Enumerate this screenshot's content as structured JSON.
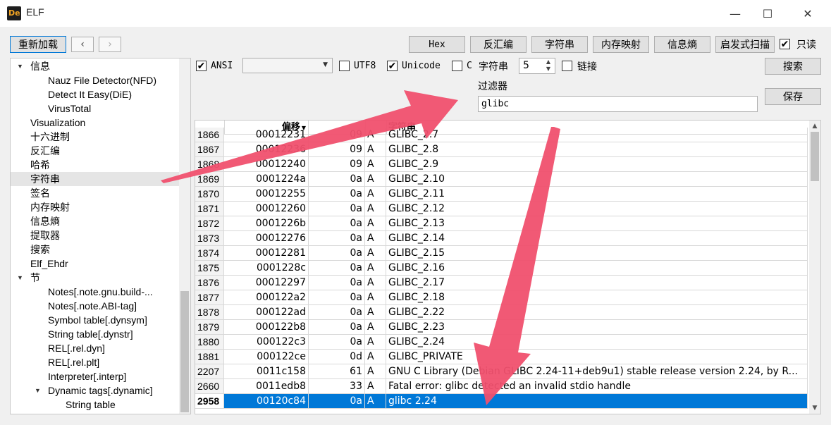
{
  "window": {
    "title": "ELF",
    "minimize": "—",
    "maximize": "☐",
    "close": "✕",
    "app_icon_text": "De"
  },
  "toolbar": {
    "reload_label": "重新加载",
    "back_glyph": "‹",
    "forward_glyph": "›",
    "tabs": [
      "Hex",
      "反汇编",
      "字符串",
      "内存映射",
      "信息熵",
      "启发式扫描"
    ],
    "readonly_label": "只读",
    "readonly_checked": true
  },
  "filters": {
    "ansi_label": "ANSI",
    "ansi_checked": true,
    "encoding_value": "",
    "utf8_label": "UTF8",
    "utf8_checked": false,
    "unicode_label": "Unicode",
    "unicode_checked": true,
    "c_label": "C",
    "c_checked": false,
    "string_label": "字符串",
    "min_length": "5",
    "link_label": "链接",
    "link_checked": false,
    "search_label": "搜索",
    "filter_label": "过滤器",
    "filter_value": "glibc",
    "save_label": "保存"
  },
  "tree": [
    {
      "label": "信息",
      "level": 0,
      "expanded": true
    },
    {
      "label": "Nauz File Detector(NFD)",
      "level": 2
    },
    {
      "label": "Detect It Easy(DiE)",
      "level": 2
    },
    {
      "label": "VirusTotal",
      "level": 2
    },
    {
      "label": "Visualization",
      "level": 1
    },
    {
      "label": "十六进制",
      "level": 1
    },
    {
      "label": "反汇编",
      "level": 1
    },
    {
      "label": "哈希",
      "level": 1
    },
    {
      "label": "字符串",
      "level": 1,
      "selected": true
    },
    {
      "label": "签名",
      "level": 1
    },
    {
      "label": "内存映射",
      "level": 1
    },
    {
      "label": "信息熵",
      "level": 1
    },
    {
      "label": "提取器",
      "level": 1
    },
    {
      "label": "搜索",
      "level": 1
    },
    {
      "label": "Elf_Ehdr",
      "level": 1
    },
    {
      "label": "节",
      "level": 0,
      "expanded": true
    },
    {
      "label": "Notes[.note.gnu.build-...",
      "level": 2
    },
    {
      "label": "Notes[.note.ABI-tag]",
      "level": 2
    },
    {
      "label": "Symbol table[.dynsym]",
      "level": 2
    },
    {
      "label": "String table[.dynstr]",
      "level": 2
    },
    {
      "label": "REL[.rel.dyn]",
      "level": 2
    },
    {
      "label": "REL[.rel.plt]",
      "level": 2
    },
    {
      "label": "Interpreter[.interp]",
      "level": 2
    },
    {
      "label": "Dynamic tags[.dynamic]",
      "level": 2,
      "expanded": true,
      "arrow": true
    },
    {
      "label": "String table",
      "level": 3
    }
  ],
  "table": {
    "offset_header": "偏移",
    "string_header": "字符串",
    "rows": [
      {
        "idx": "1866",
        "offset": "00012231",
        "size": "09",
        "type": "A",
        "str": "GLIBC_2.7"
      },
      {
        "idx": "1867",
        "offset": "00012236",
        "size": "09",
        "type": "A",
        "str": "GLIBC_2.8"
      },
      {
        "idx": "1868",
        "offset": "00012240",
        "size": "09",
        "type": "A",
        "str": "GLIBC_2.9"
      },
      {
        "idx": "1869",
        "offset": "0001224a",
        "size": "0a",
        "type": "A",
        "str": "GLIBC_2.10"
      },
      {
        "idx": "1870",
        "offset": "00012255",
        "size": "0a",
        "type": "A",
        "str": "GLIBC_2.11"
      },
      {
        "idx": "1871",
        "offset": "00012260",
        "size": "0a",
        "type": "A",
        "str": "GLIBC_2.12"
      },
      {
        "idx": "1872",
        "offset": "0001226b",
        "size": "0a",
        "type": "A",
        "str": "GLIBC_2.13"
      },
      {
        "idx": "1873",
        "offset": "00012276",
        "size": "0a",
        "type": "A",
        "str": "GLIBC_2.14"
      },
      {
        "idx": "1874",
        "offset": "00012281",
        "size": "0a",
        "type": "A",
        "str": "GLIBC_2.15"
      },
      {
        "idx": "1875",
        "offset": "0001228c",
        "size": "0a",
        "type": "A",
        "str": "GLIBC_2.16"
      },
      {
        "idx": "1876",
        "offset": "00012297",
        "size": "0a",
        "type": "A",
        "str": "GLIBC_2.17"
      },
      {
        "idx": "1877",
        "offset": "000122a2",
        "size": "0a",
        "type": "A",
        "str": "GLIBC_2.18"
      },
      {
        "idx": "1878",
        "offset": "000122ad",
        "size": "0a",
        "type": "A",
        "str": "GLIBC_2.22"
      },
      {
        "idx": "1879",
        "offset": "000122b8",
        "size": "0a",
        "type": "A",
        "str": "GLIBC_2.23"
      },
      {
        "idx": "1880",
        "offset": "000122c3",
        "size": "0a",
        "type": "A",
        "str": "GLIBC_2.24"
      },
      {
        "idx": "1881",
        "offset": "000122ce",
        "size": "0d",
        "type": "A",
        "str": "GLIBC_PRIVATE"
      },
      {
        "idx": "2207",
        "offset": "0011c158",
        "size": "61",
        "type": "A",
        "str": "GNU C Library (Debian GLIBC 2.24-11+deb9u1) stable release version 2.24, by R..."
      },
      {
        "idx": "2660",
        "offset": "0011edb8",
        "size": "33",
        "type": "A",
        "str": "Fatal error: glibc detected an invalid stdio handle"
      },
      {
        "idx": "2958",
        "offset": "00120c84",
        "size": "0a",
        "type": "A",
        "str": "glibc 2.24",
        "selected": true
      }
    ]
  },
  "colors": {
    "accent": "#0078d7",
    "annotation_arrow": "#f0506e"
  }
}
